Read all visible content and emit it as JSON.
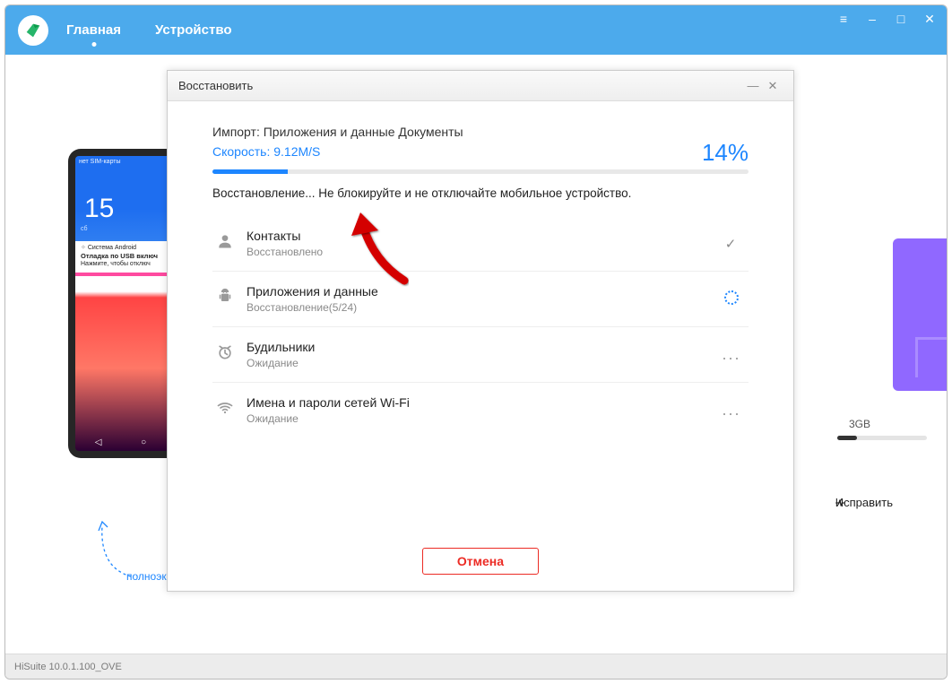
{
  "header": {
    "nav": [
      "Главная",
      "Устройство"
    ],
    "active_index": 0
  },
  "phone": {
    "status_left": "нет SIM-карты",
    "status_right": "◧ ▮",
    "time": "15",
    "day": "сб",
    "notif_from": "Система Android",
    "notif_title": "Отладка по USB включ",
    "notif_sub": "Нажмите, чтобы отключ"
  },
  "hint_link": "полноэкранной",
  "storage": {
    "label": "3GB"
  },
  "fix_label": "Исправить",
  "modal": {
    "title": "Восстановить",
    "import_label": "Импорт: Приложения и данные  Документы",
    "speed_label": "Скорость: 9.12M/S",
    "percent_label": "14%",
    "progress_pct": 14,
    "restoring_msg": "Восстановление... Не блокируйте и не отключайте мобильное устройство.",
    "categories": [
      {
        "icon": "person",
        "title": "Контакты",
        "status": "Восстановлено",
        "state": "done"
      },
      {
        "icon": "android",
        "title": "Приложения и данные",
        "status": "Восстановление(5/24)",
        "state": "loading"
      },
      {
        "icon": "alarm",
        "title": "Будильники",
        "status": "Ожидание",
        "state": "pending"
      },
      {
        "icon": "wifi",
        "title": "Имена и пароли сетей Wi-Fi",
        "status": "Ожидание",
        "state": "pending"
      }
    ],
    "cancel_label": "Отмена"
  },
  "footer": {
    "version": "HiSuite 10.0.1.100_OVE"
  }
}
